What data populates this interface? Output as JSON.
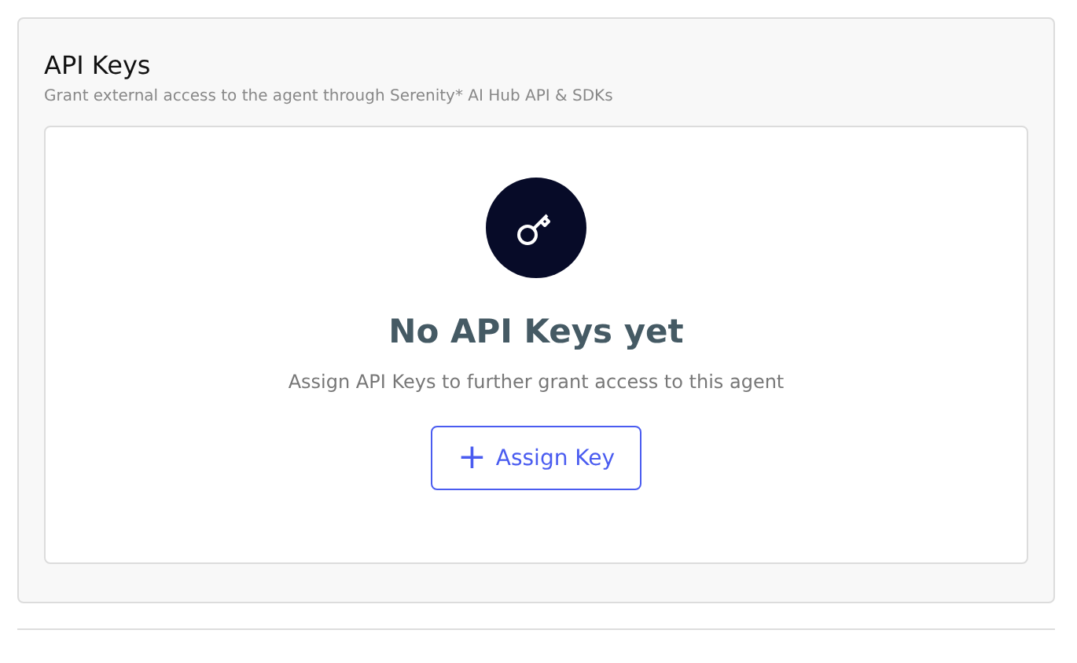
{
  "section": {
    "title": "API Keys",
    "subtitle": "Grant external access to the agent through Serenity* AI Hub API & SDKs"
  },
  "empty_state": {
    "heading": "No API Keys yet",
    "description": "Assign API Keys to further grant access to this agent",
    "button": {
      "icon": "+",
      "label": "Assign Key"
    }
  }
}
